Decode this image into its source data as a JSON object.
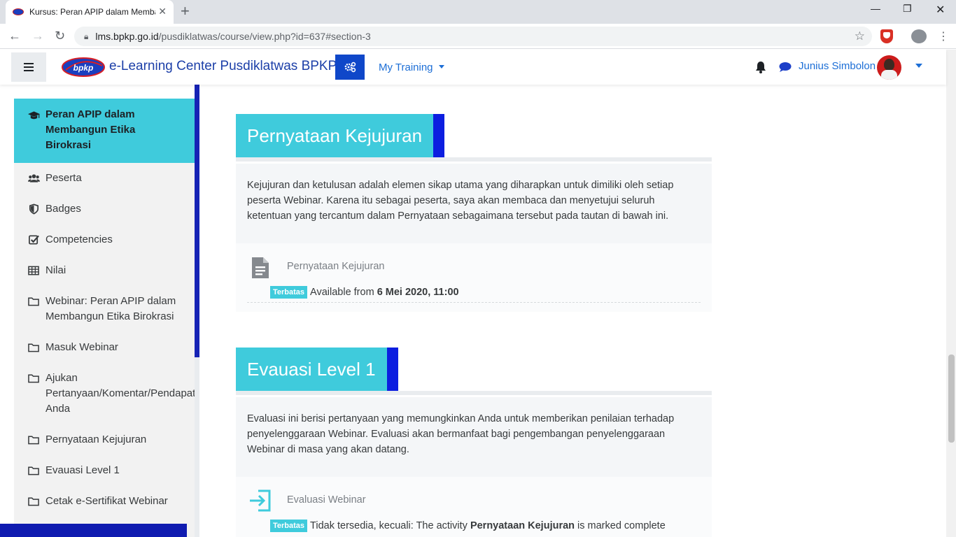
{
  "browser": {
    "tab_title": "Kursus: Peran APIP dalam Membangun Etika Birokrasi",
    "url_host": "lms.bpkp.go.id",
    "url_path": "/pusdiklatwas/course/view.php?id=637#section-3"
  },
  "navbar": {
    "logo_text": "bpkp",
    "site_name": "e-Learning Center Pusdiklatwas BPKP",
    "my_training": "My Training",
    "user_name": "Junius Simbolon"
  },
  "drawer": {
    "items": [
      {
        "label": "Peran APIP dalam\nMembangun Etika\nBirokrasi",
        "icon": "graduation-cap-icon"
      },
      {
        "label": "Peserta",
        "icon": "users-icon"
      },
      {
        "label": "Badges",
        "icon": "shield-icon"
      },
      {
        "label": "Competencies",
        "icon": "check-square-icon"
      },
      {
        "label": "Nilai",
        "icon": "table-icon"
      },
      {
        "label": "Webinar: Peran APIP dalam\nMembangun Etika Birokrasi",
        "icon": "folder-icon"
      },
      {
        "label": "Masuk Webinar",
        "icon": "folder-icon"
      },
      {
        "label": "Ajukan\nPertanyaan/Komentar/Pendapat\nAnda",
        "icon": "folder-icon"
      },
      {
        "label": "Pernyataan Kejujuran",
        "icon": "folder-icon"
      },
      {
        "label": "Evauasi Level 1",
        "icon": "folder-icon"
      },
      {
        "label": "Cetak e-Sertifikat Webinar",
        "icon": "folder-icon"
      }
    ]
  },
  "sections": [
    {
      "title": "Pernyataan Kejujuran",
      "summary": "Kejujuran dan ketulusan adalah elemen sikap utama yang diharapkan untuk dimiliki oleh setiap peserta Webinar. Karena itu sebagai peserta, saya akan membaca dan menyetujui seluruh ketentuan yang tercantum dalam Pernyataan sebagaimana tersebut pada tautan di bawah ini.",
      "activity": {
        "name": "Pernyataan Kejujuran",
        "badge": "Terbatas",
        "restriction_prefix": "Available from ",
        "restriction_bold": "6 Mei 2020, 11:00",
        "restriction_suffix": ""
      }
    },
    {
      "title": "Evauasi Level 1",
      "summary": "Evaluasi ini berisi pertanyaan yang memungkinkan Anda untuk memberikan penilaian terhadap penyelenggaraan Webinar. Evaluasi akan bermanfaat bagi pengembangan penyelenggaraan Webinar di masa yang akan datang.",
      "activity": {
        "name": "Evaluasi Webinar",
        "badge": "Terbatas",
        "restriction_prefix": "Tidak tersedia, kecuali: The activity ",
        "restriction_bold": "Pernyataan Kejujuran",
        "restriction_suffix": " is marked complete"
      }
    }
  ],
  "colors": {
    "accent_cyan": "#3fcbdc",
    "accent_blue": "#0c1ee0",
    "link_blue": "#1c6ed6"
  }
}
